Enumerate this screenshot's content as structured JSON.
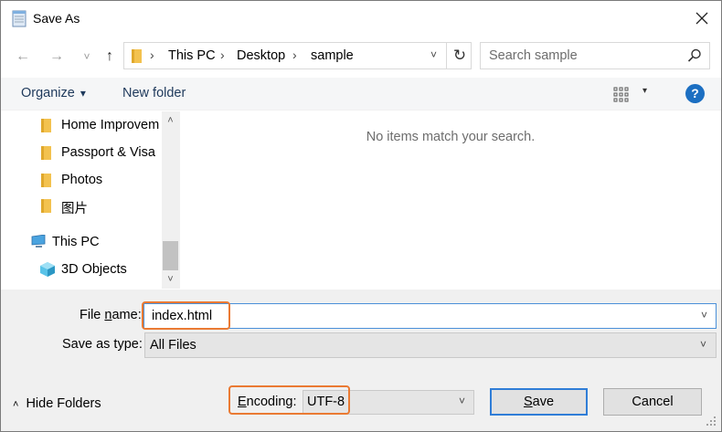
{
  "window": {
    "title": "Save As",
    "close_glyph": "✕"
  },
  "address": {
    "back_glyph": "←",
    "forward_glyph": "→",
    "recent_glyph": "˅",
    "up_glyph": "↑",
    "breadcrumbs": [
      "This PC",
      "Desktop",
      "sample"
    ],
    "separator_glyph": "›",
    "dropdown_glyph": "˅",
    "refresh_glyph": "↻"
  },
  "search": {
    "placeholder": "Search sample"
  },
  "toolbar": {
    "organize_label": "Organize",
    "organize_caret": "▾",
    "new_folder_label": "New folder",
    "view_caret": "▾",
    "help_glyph": "?"
  },
  "nav_pane": {
    "items": [
      {
        "label": "Home Improvem",
        "icon": "folder-icon"
      },
      {
        "label": "Passport & Visa",
        "icon": "folder-icon"
      },
      {
        "label": "Photos",
        "icon": "folder-icon"
      },
      {
        "label": "图片",
        "icon": "folder-icon"
      },
      {
        "label": "This PC",
        "icon": "computer-icon"
      },
      {
        "label": "3D Objects",
        "icon": "3d-objects-icon"
      }
    ],
    "scroll_up_glyph": "˄",
    "scroll_down_glyph": "˅"
  },
  "file_list": {
    "empty_message": "No items match your search."
  },
  "form": {
    "file_name_label_pre": "File ",
    "file_name_label_mn": "n",
    "file_name_label_post": "ame:",
    "file_name_value": "index.html",
    "save_as_type_label": "Save as type:",
    "save_as_type_value": "All Files",
    "encoding_label_mn": "E",
    "encoding_label_post": "ncoding:",
    "encoding_value": "UTF-8",
    "dropdown_glyph": "˅"
  },
  "footer": {
    "hide_folders_label": "Hide Folders",
    "hide_folders_glyph": "˄",
    "save_label_mn": "S",
    "save_label_post": "ave",
    "cancel_label": "Cancel"
  },
  "colors": {
    "highlight_border": "#ea7a33",
    "primary_button_border": "#2f7dd7",
    "help_icon": "#1c6fc2",
    "folder": "#f3c24f"
  }
}
